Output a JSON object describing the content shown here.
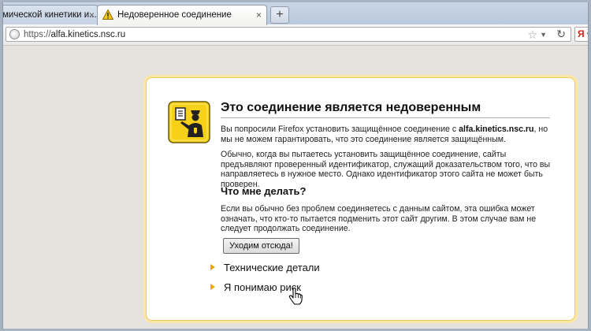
{
  "browser": {
    "tabs": [
      {
        "title": "мической кинетики и...",
        "close": "×",
        "active": false
      },
      {
        "title": "Недоверенное соединение",
        "close": "×",
        "active": true
      }
    ],
    "new_tab": "+",
    "url": {
      "prefix": "https://",
      "host": "alfa.kinetics.nsc.ru"
    },
    "search_engine_glyph": "Я"
  },
  "error_page": {
    "title": "Это соединение является недоверенным",
    "intro": {
      "before": "Вы попросили Firefox установить защищённое соединение с ",
      "host": "alfa.kinetics.nsc.ru",
      "after": ", но мы не можем гарантировать, что это соединение является защищённым."
    },
    "explanation": "Обычно, когда вы пытаетесь установить защищённое соединение, сайты предъявляют проверенный идентификатор, служащий доказательством того, что вы направляетесь в нужное место. Однако идентификатор этого сайта не может быть проверен.",
    "what_to_do_title": "Что мне делать?",
    "what_to_do_text": "Если вы обычно без проблем соединяетесь с данным сайтом, эта ошибка может означать, что кто-то пытается подменить этот сайт другим. В этом случае вам не следует продолжать соединение.",
    "leave_button": "Уходим отсюда!",
    "technical_details": "Технические детали",
    "understand_risks": "Я понимаю риск"
  },
  "colors": {
    "box_border": "#f0c860",
    "expander_triangle": "#f0a500",
    "cert_icon_bg": "#f7d117"
  }
}
